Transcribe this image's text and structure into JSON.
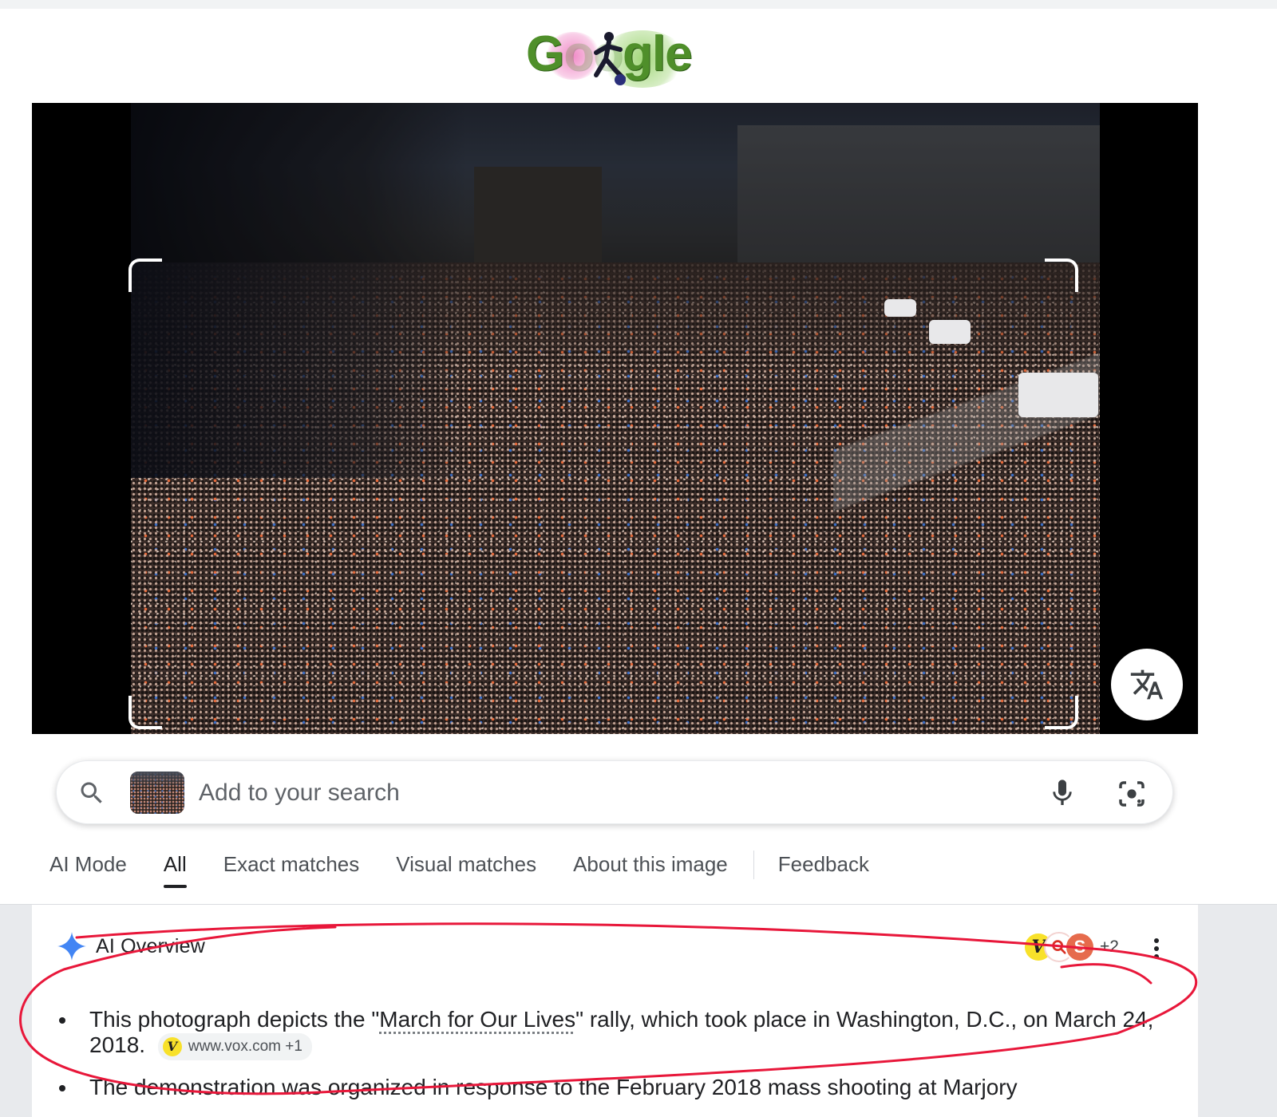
{
  "header": {
    "logo_text": "Google",
    "logo_description": "doodle-logo-runner"
  },
  "image_panel": {
    "translate_icon": "translate-icon"
  },
  "search": {
    "placeholder": "Add to your search",
    "value": "",
    "search_icon": "search-icon",
    "mic_icon": "mic-icon",
    "lens_icon": "lens-camera-icon"
  },
  "tabs": [
    {
      "label": "AI Mode",
      "active": false
    },
    {
      "label": "All",
      "active": true
    },
    {
      "label": "Exact matches",
      "active": false
    },
    {
      "label": "Visual matches",
      "active": false
    },
    {
      "label": "About this image",
      "active": false
    },
    {
      "label": "Feedback",
      "active": false
    }
  ],
  "ai_overview": {
    "title": "AI Overview",
    "sources_extra": "+2",
    "bullets": [
      {
        "text_before": "This photograph depicts the \"",
        "link_text": "March for Our Lives",
        "text_after": "\" rally, which took place in Washington, D.C., on March 24, 2018.",
        "chip_label": "www.vox.com +1"
      },
      {
        "text": "The demonstration was organized in response to the February 2018 mass shooting at Marjory"
      }
    ]
  },
  "colors": {
    "accent_star": "#4285f4",
    "annotation_red": "#e8173a",
    "source_v": "#f8e12a",
    "source_s": "#e66b4c"
  }
}
